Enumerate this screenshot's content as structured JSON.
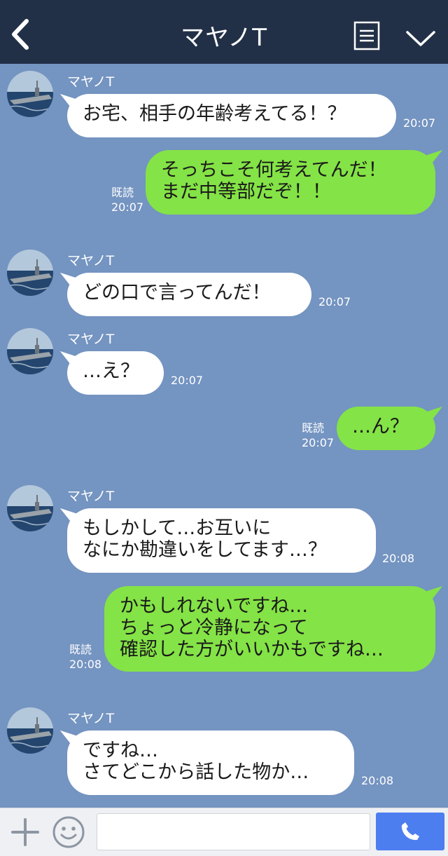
{
  "header": {
    "title": "マヤノT",
    "icons": {
      "back": "back-arrow-icon",
      "menu": "menu-list-icon",
      "collapse": "chevron-down-icon"
    }
  },
  "colors": {
    "header_bg": "#223047",
    "chat_bg": "#7494c1",
    "incoming_bubble": "#ffffff",
    "outgoing_bubble": "#84e346",
    "send_button": "#4d7ef0"
  },
  "messages": [
    {
      "direction": "in",
      "sender": "マヤノT",
      "text": "お宅、相手の年齢考えてる！？",
      "time": "20:07"
    },
    {
      "direction": "out",
      "text": "そっちこそ何考えてんだ！\nまだ中等部だぞ！！",
      "read": "既読",
      "time": "20:07"
    },
    {
      "direction": "in",
      "sender": "マヤノT",
      "text": "どの口で言ってんだ！",
      "time": "20:07"
    },
    {
      "direction": "in",
      "sender": "マヤノT",
      "text": "…え？",
      "time": "20:07"
    },
    {
      "direction": "out",
      "text": "…ん？",
      "read": "既読",
      "time": "20:07"
    },
    {
      "direction": "in",
      "sender": "マヤノT",
      "text": "もしかして…お互いに\nなにか勘違いをしてます…？",
      "time": "20:08"
    },
    {
      "direction": "out",
      "text": "かもしれないですね…\nちょっと冷静になって\n確認した方がいいかもですね…",
      "read": "既読",
      "time": "20:08"
    },
    {
      "direction": "in",
      "sender": "マヤノT",
      "text": "ですね…\nさてどこから話した物か…",
      "time": "20:08"
    }
  ],
  "footer": {
    "input_value": "",
    "icons": {
      "plus": "plus-icon",
      "emoji": "smiley-icon",
      "call": "phone-icon"
    }
  }
}
